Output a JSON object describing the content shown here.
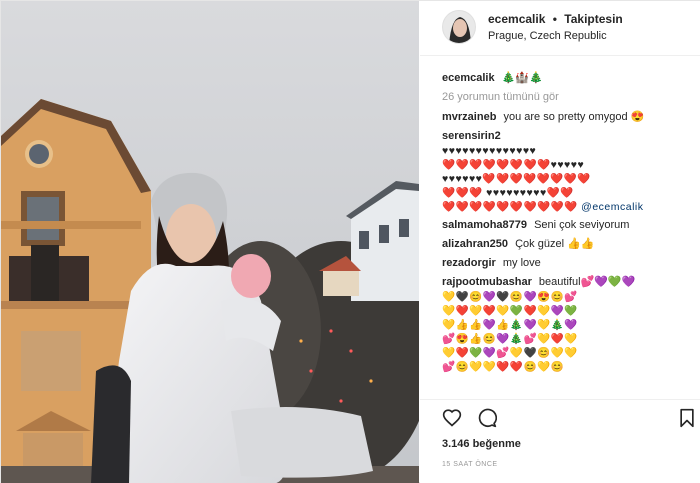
{
  "header": {
    "username": "ecemcalik",
    "separator": "•",
    "follow_status": "Takiptesin",
    "location": "Prague, Czech Republic"
  },
  "caption": {
    "username": "ecemcalik",
    "text": "🎄🏰🎄"
  },
  "view_all_comments": "26 yorumun tümünü gör",
  "comments": [
    {
      "username": "mvrzaineb",
      "text": "you are so pretty omygod 😍"
    },
    {
      "username": "serensirin2",
      "rows": [
        "♥♥♥♥♥♥♥♥♥♥♥♥♥♥",
        "❤️❤️❤️❤️❤️❤️❤️❤️♥♥♥♥♥",
        "♥♥♥♥♥♥❤️❤️❤️❤️❤️❤️❤️❤️",
        "❤️❤️❤️ ♥♥♥♥♥♥♥♥♥❤️❤️",
        "❤️❤️❤️❤️❤️❤️❤️❤️❤️❤️"
      ],
      "mention": "@ecemcalik"
    },
    {
      "username": "salmamoha8779",
      "text": "Seni çok seviyorum"
    },
    {
      "username": "alizahran250",
      "text": "Çok güzel 👍👍"
    },
    {
      "username": "rezadorgir",
      "text": "my love"
    },
    {
      "username": "rajpootmubashar",
      "text": "beautiful💕💜💚💜",
      "rows": [
        "💛🖤😊💜🖤😊💜😍😊💕",
        "💛❤️💛❤️💛💚❤️💛💜💚",
        "💛👍👍💜👍🎄💜💛🎄💜",
        "💕😍👍😊💜🎄💕💛❤️💛",
        "💛❤️💚💜💕💛🖤😊💛💛",
        "💕😊💛💛❤️❤️😊💛😊"
      ]
    }
  ],
  "likes": "3.146 beğenme",
  "timestamp": "15 SAAT ÖNCE",
  "icons": {
    "like": "heart-icon",
    "comment": "comment-bubble-icon",
    "save": "bookmark-icon"
  }
}
